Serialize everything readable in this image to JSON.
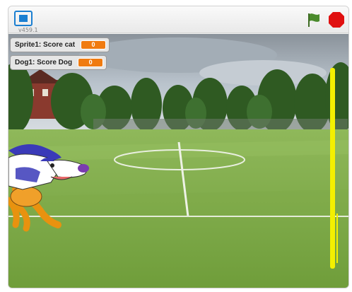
{
  "header": {
    "version": "v459.1",
    "fullscreen_icon": "fullscreen-icon",
    "green_flag_icon": "green-flag-icon",
    "stop_icon": "stop-sign-icon"
  },
  "monitors": [
    {
      "label": "Sprite1: Score cat",
      "value": "0"
    },
    {
      "label": "Dog1: Score Dog",
      "value": "0"
    }
  ],
  "colors": {
    "monitor_value": "#f07b10",
    "flag": "#4a8a2c",
    "stop": "#e01010",
    "paddle": "#f4f000"
  }
}
